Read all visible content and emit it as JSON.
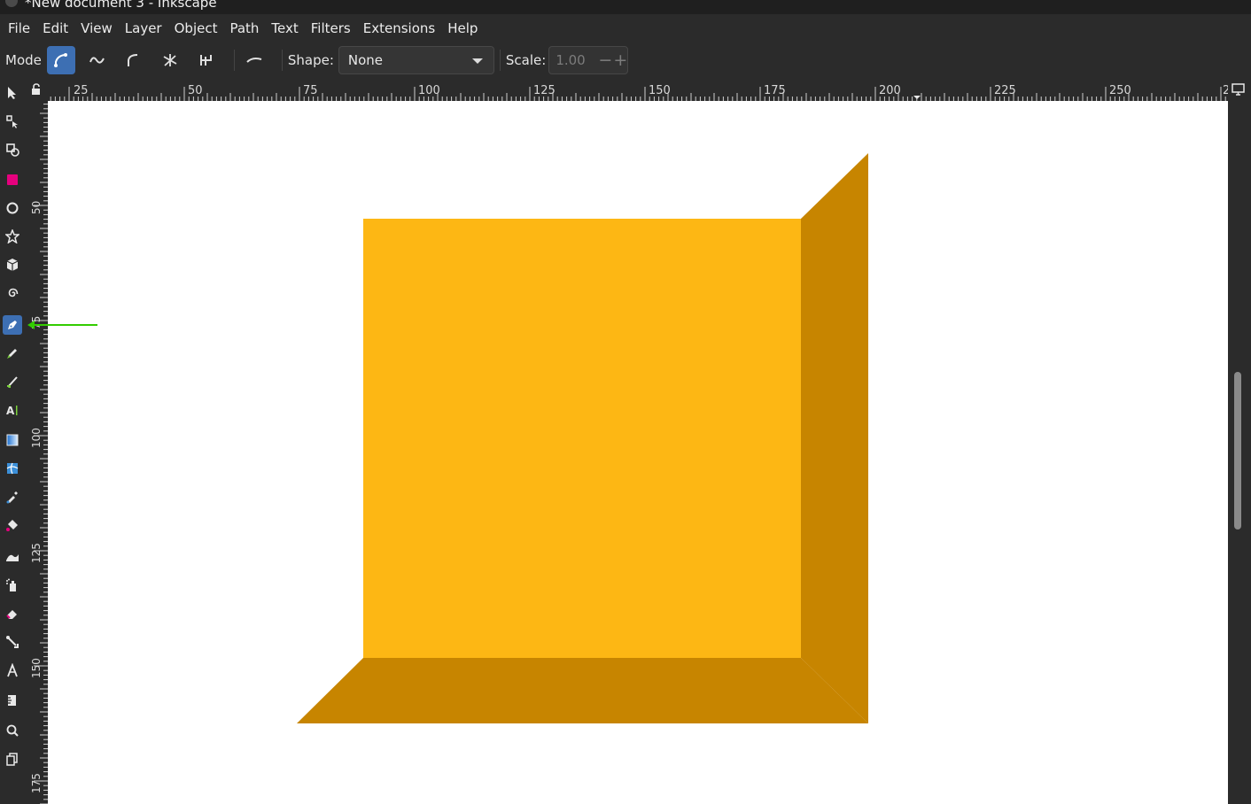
{
  "window": {
    "title": "*New document 3 - Inkscape"
  },
  "menu": [
    "File",
    "Edit",
    "View",
    "Layer",
    "Object",
    "Path",
    "Text",
    "Filters",
    "Extensions",
    "Help"
  ],
  "toolbar": {
    "mode_label": "Mode",
    "mode_buttons": [
      "bezier-mode-icon",
      "spiro-mode-icon",
      "bspline-mode-icon",
      "paraxial-mode-icon",
      "paraxial-alt-mode-icon",
      "sketch-mode-icon"
    ],
    "active_mode": "bezier-mode-icon",
    "shape_label": "Shape:",
    "shape_value": "None",
    "scale_label": "Scale:",
    "scale_value": "1.00"
  },
  "toolbox": {
    "tools": [
      "selector-icon",
      "node-icon",
      "tweak-shapes-icon",
      "rectangle-icon",
      "ellipse-icon",
      "star-icon",
      "box-3d-icon",
      "spiral-icon",
      "pen-icon",
      "pencil-icon",
      "calligraphy-icon",
      "text-icon",
      "gradient-icon",
      "mesh-icon",
      "dropper-icon",
      "paint-bucket-icon",
      "tweak-icon",
      "spray-icon",
      "eraser-icon",
      "connector-icon",
      "lpe-tool-icon",
      "measure-icon",
      "zoom-icon",
      "pages-icon"
    ],
    "active_tool": "pen-icon"
  },
  "rulers": {
    "horizontal_labels": [
      "25",
      "50",
      "75",
      "100",
      "125",
      "150",
      "175",
      "200",
      "225",
      "250",
      "2"
    ],
    "vertical_labels": [
      "50",
      "75",
      "100",
      "125",
      "150",
      "175"
    ]
  },
  "canvas": {
    "background": "#ffffff",
    "front_face_color": "#fdb714",
    "side_face_color": "#c78500"
  },
  "annotation": {
    "arrow_color": "#33cc00"
  }
}
